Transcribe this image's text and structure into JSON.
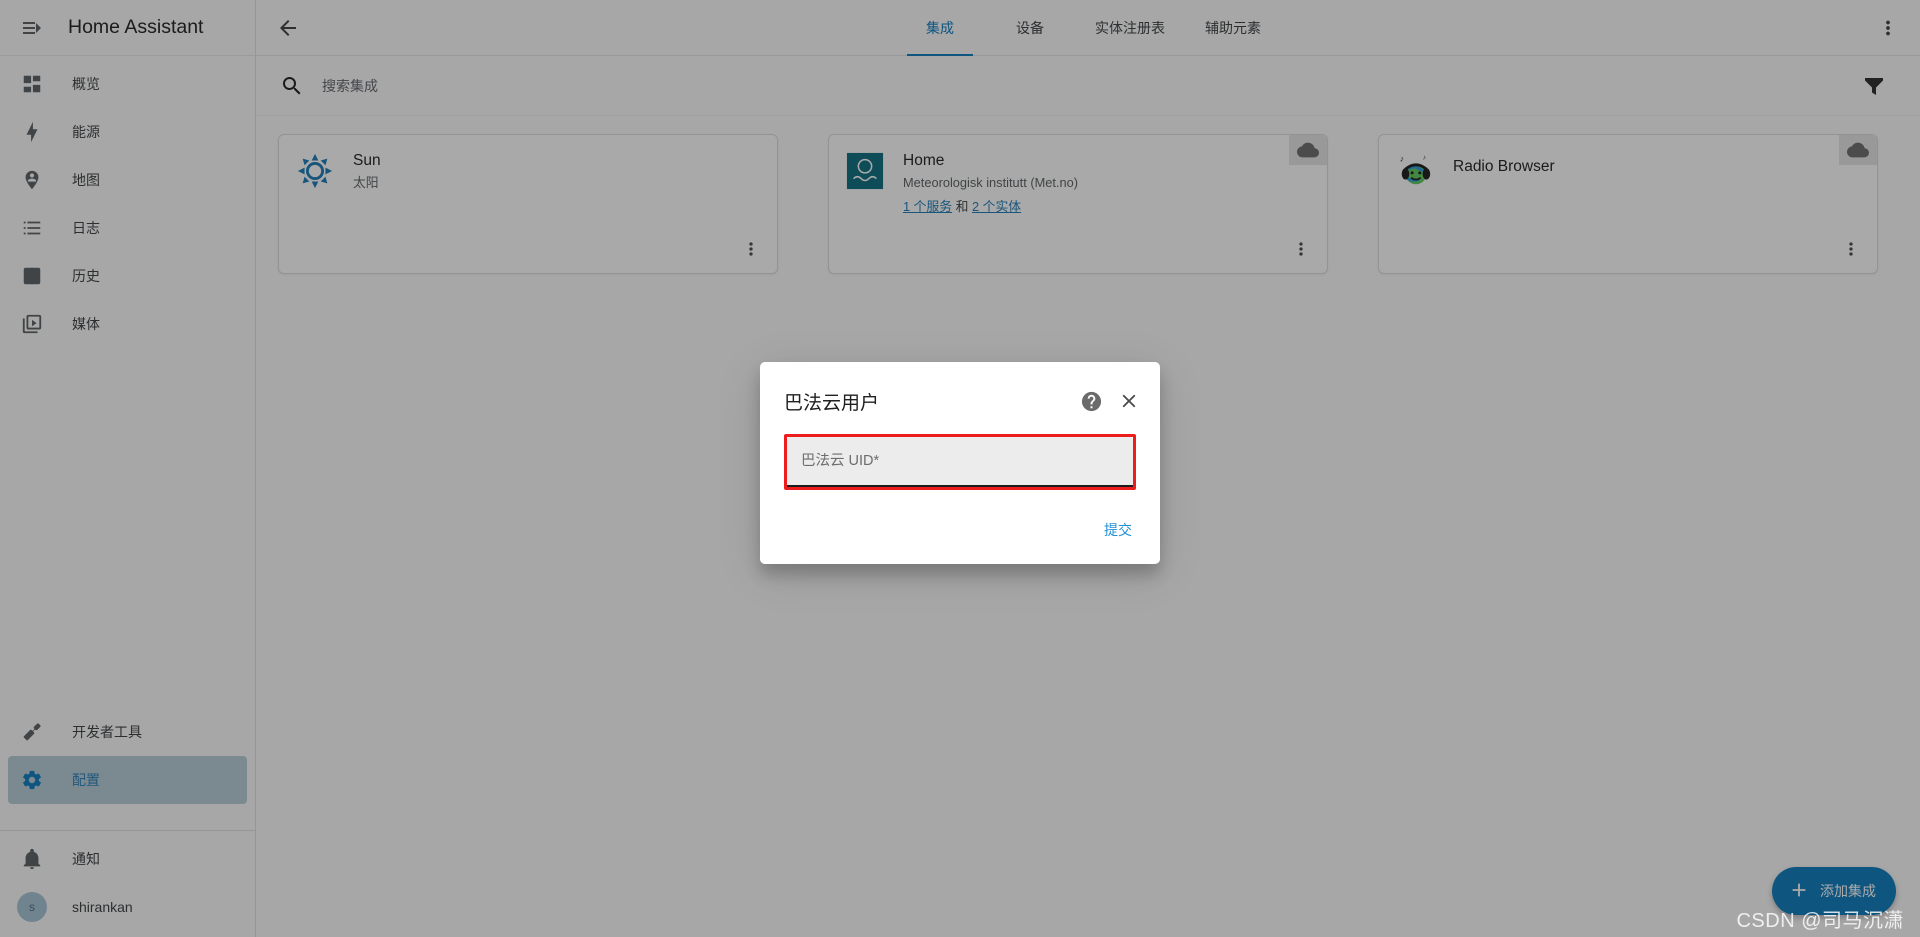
{
  "sidebar": {
    "title": "Home Assistant",
    "menu_icon": "menu-open-icon",
    "items": [
      {
        "label": "概览",
        "icon": "view-dashboard-icon",
        "active": false
      },
      {
        "label": "能源",
        "icon": "lightning-bolt-icon",
        "active": false
      },
      {
        "label": "地图",
        "icon": "map-marker-account-icon",
        "active": false
      },
      {
        "label": "日志",
        "icon": "format-list-bulleted-icon",
        "active": false
      },
      {
        "label": "历史",
        "icon": "chart-box-icon",
        "active": false
      },
      {
        "label": "媒体",
        "icon": "play-box-multiple-icon",
        "active": false
      }
    ],
    "tools": [
      {
        "label": "开发者工具",
        "icon": "hammer-icon",
        "active": false
      },
      {
        "label": "配置",
        "icon": "gear-icon",
        "active": true
      }
    ],
    "bottom": [
      {
        "label": "通知",
        "icon": "bell-icon"
      }
    ],
    "user": {
      "name": "shirankan",
      "initial": "s"
    }
  },
  "toolbar": {
    "back_icon": "arrow-left-icon",
    "more_icon": "dots-vertical-icon",
    "tabs": [
      {
        "label": "集成",
        "active": true
      },
      {
        "label": "设备",
        "active": false
      },
      {
        "label": "实体注册表",
        "active": false
      },
      {
        "label": "辅助元素",
        "active": false
      }
    ]
  },
  "search": {
    "placeholder": "搜索集成",
    "value": "",
    "icon": "search-icon",
    "filter_icon": "filter-icon"
  },
  "integrations": [
    {
      "title": "Sun",
      "subtitle": "太阳",
      "logo": "sun-logo",
      "cloud": false,
      "links": []
    },
    {
      "title": "Home",
      "subtitle": "Meteorologisk institutt (Met.no)",
      "logo": "met-logo",
      "cloud": true,
      "links": [
        {
          "text": "1 个服务",
          "type": "link"
        },
        {
          "text": " 和 ",
          "type": "plain"
        },
        {
          "text": "2 个实体",
          "type": "link"
        }
      ]
    },
    {
      "title": "Radio Browser",
      "subtitle": "",
      "logo": "radio-browser-logo",
      "cloud": true,
      "links": []
    }
  ],
  "fab": {
    "label": "添加集成",
    "icon": "plus-icon",
    "color": "#0b7bbd"
  },
  "dialog": {
    "title": "巴法云用户",
    "help_icon": "help-circle-icon",
    "close_icon": "close-icon",
    "field": {
      "placeholder": "巴法云 UID*",
      "value": "",
      "highlight_color": "#ee1d1d"
    },
    "submit_label": "提交"
  },
  "watermark": "CSDN @司马沉潇",
  "colors": {
    "accent": "#0b7bbd",
    "sidebar_active_bg": "#b6ccd8",
    "link": "#1f7ab8",
    "error": "#ee1d1d"
  }
}
